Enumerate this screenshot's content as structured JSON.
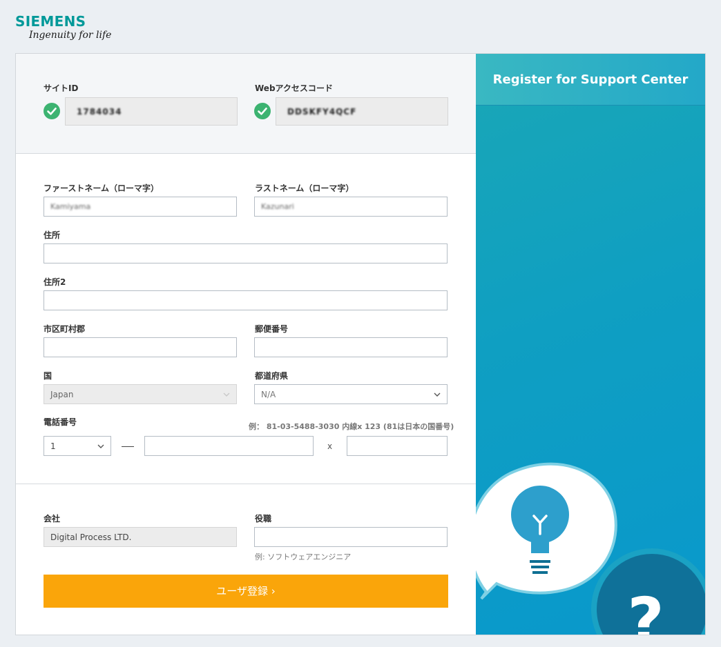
{
  "logo": {
    "brand": "SIEMENS",
    "tagline": "Ingenuity for life"
  },
  "site": {
    "site_id_label": "サイトID",
    "site_id_value": "1784034",
    "web_code_label": "Webアクセスコード",
    "web_code_value": "DDSKFY4QCF"
  },
  "person": {
    "first_name_label": "ファーストネーム（ローマ字）",
    "first_name_value": "Kamiyama",
    "last_name_label": "ラストネーム（ローマ字）",
    "last_name_value": "Kazunari",
    "address_label": "住所",
    "address_value": "",
    "address2_label": "住所2",
    "address2_value": "",
    "city_label": "市区町村郡",
    "city_value": "",
    "postal_label": "郵便番号",
    "postal_value": "",
    "country_label": "国",
    "country_value": "Japan",
    "prefecture_label": "都道府県",
    "prefecture_value": "N/A",
    "phone_label": "電話番号",
    "phone_hint": "例： 81-03-5488-3030 内線x 123 (81は日本の国番号)",
    "phone_country_code": "1",
    "phone_number": "",
    "phone_ext_separator": "x",
    "phone_ext": ""
  },
  "company": {
    "company_label": "会社",
    "company_value": "Digital Process LTD.",
    "title_label": "役職",
    "title_value": "",
    "title_hint": "例: ソフトウェアエンジニア"
  },
  "submit_label": "ユーザ登録 ›",
  "sidebar": {
    "title": "Register for Support Center"
  },
  "colors": {
    "brand": "#009999",
    "accent_button": "#faa50a",
    "sidebar": "#0998cc",
    "success": "#3cb371"
  }
}
